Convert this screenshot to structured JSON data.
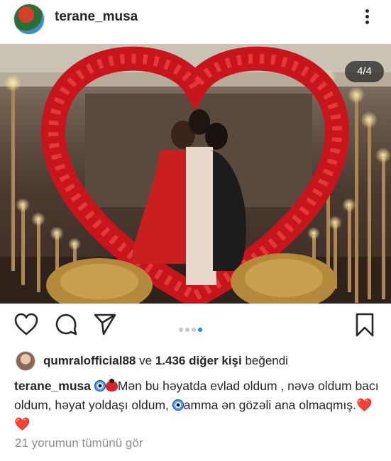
{
  "post": {
    "username": "terane_musa",
    "photo_counter": "4/4"
  },
  "likes": {
    "liker": "qumralofficial88",
    "connector": "ve",
    "others": "1.436 diğer kişi",
    "suffix": "beğendi"
  },
  "caption": {
    "author": "terane_musa",
    "text_part1": "Mən bu həyatda evlad oldum , nəvə oldum bacı oldum, həyat yoldaşı oldum,",
    "text_part2": "amma ən gözəli ana olmaqmış.",
    "hearts": "❤️❤️"
  },
  "comments_link": "21 yorumun tümünü gör",
  "carousel": {
    "total": 4,
    "active_index": 3
  },
  "icons": [
    "more-icon",
    "heart-icon",
    "comment-icon",
    "share-icon",
    "bookmark-icon"
  ],
  "colors": {
    "active_dot": "#0095f6",
    "text": "#262626",
    "muted": "#8e8e8e"
  }
}
